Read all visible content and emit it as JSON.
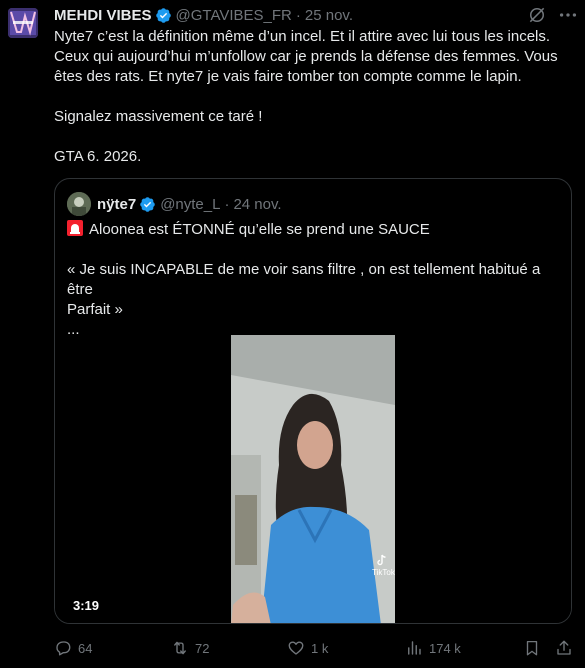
{
  "tweet": {
    "author_name": "MEHDI VIBES",
    "handle": "@GTAVIBES_FR",
    "separator": "·",
    "date": "25 nov.",
    "text_lines": [
      "Nyte7 c’est la définition même d’un incel. Et il attire avec lui tous les incels.",
      "Ceux qui aujourd’hui m’unfollow car je prends la défense des femmes. Vous",
      "êtes des rats. Et nyte7 je vais faire tomber ton compte comme le lapin.",
      "",
      "Signalez massivement ce taré !",
      "",
      "GTA 6. 2026."
    ]
  },
  "quote": {
    "author_name": "nÿte7",
    "handle": "@nyte_L",
    "separator": "·",
    "date": "24 nov.",
    "line1": "Aloonea est ÉTONNÉ qu’elle se prend une SAUCE",
    "line2": "",
    "line3": "« Je suis INCAPABLE de me voir sans filtre , on est tellement habitué a être",
    "line4": "Parfait »",
    "line5": "...",
    "video_duration": "3:19",
    "watermark": "TikTok"
  },
  "actions": {
    "replies": "64",
    "retweets": "72",
    "likes": "1 k",
    "views": "174 k"
  },
  "icons": {
    "verified": "verified-badge-icon",
    "grok": "grok-icon",
    "more": "more-icon",
    "siren": "siren-icon",
    "reply": "reply-icon",
    "retweet": "retweet-icon",
    "like": "heart-icon",
    "views": "views-icon",
    "bookmark": "bookmark-icon",
    "share": "share-icon"
  },
  "colors": {
    "background": "#000000",
    "text": "#e7e9ea",
    "muted": "#71767b",
    "verified": "#1d9bf0",
    "border": "#2f3336"
  }
}
